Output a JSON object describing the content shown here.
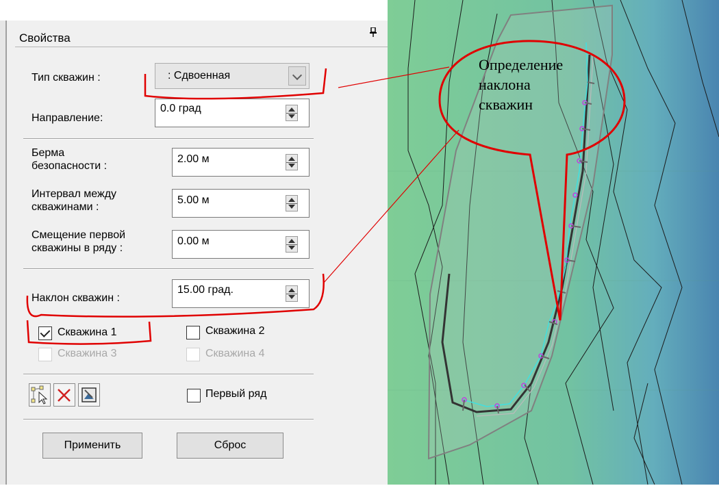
{
  "panel": {
    "title": "Свойства",
    "pin_icon": "pin-icon",
    "well_type": {
      "label": "Тип скважин :",
      "value": ": Сдвоенная"
    },
    "direction": {
      "label": "Направление:",
      "value": "0.0 град"
    },
    "berm": {
      "label": "Берма\nбезопасности :",
      "value": "2.00 м"
    },
    "interval": {
      "label": "Интервал между\nскважинами :",
      "value": "5.00 м"
    },
    "offset": {
      "label": "Смещение первой\nскважины в ряду :",
      "value": "0.00 м"
    },
    "incline": {
      "label": "Наклон скважин :",
      "value": "15.00 град."
    },
    "wells": [
      {
        "label": "Скважина 1",
        "checked": true,
        "enabled": true
      },
      {
        "label": "Скважина 2",
        "checked": false,
        "enabled": true
      },
      {
        "label": "Скважина 3",
        "checked": false,
        "enabled": false
      },
      {
        "label": "Скважина 4",
        "checked": false,
        "enabled": false
      }
    ],
    "first_row": {
      "label": "Первый ряд",
      "checked": false
    },
    "tools": [
      "select-points-icon",
      "delete-icon",
      "image-tool-icon"
    ],
    "apply_label": "Применить",
    "reset_label": "Сброс"
  },
  "annotation": {
    "text": "Определение\nнаклона\nскважин",
    "color": "#e00000"
  },
  "colors": {
    "map_green": "#7fcd96",
    "map_teal": "#64aebc",
    "map_blue": "#4a85b0",
    "polyline": "#40e0e0",
    "hole_marker": "#c040e0"
  }
}
